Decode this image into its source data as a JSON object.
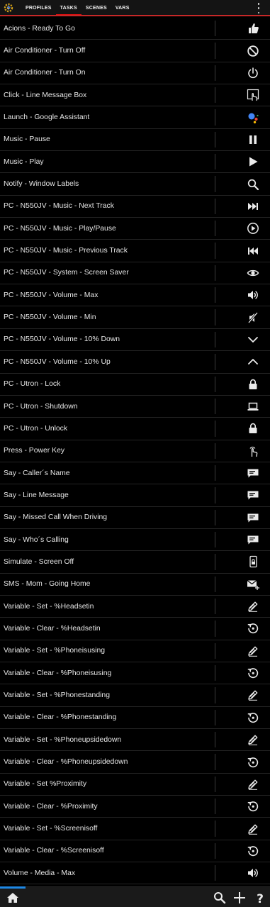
{
  "tabs": [
    {
      "label": "PROFILES",
      "active": false
    },
    {
      "label": "TASKS",
      "active": true
    },
    {
      "label": "SCENES",
      "active": false
    },
    {
      "label": "VARS",
      "active": false
    }
  ],
  "colors": {
    "accent": "#e01010",
    "progress": "#1e88e5",
    "background": "#000000"
  },
  "tasks": [
    {
      "label": "Acions - Ready To Go",
      "icon": "thumbs-up-icon"
    },
    {
      "label": "Air Conditioner - Turn Off",
      "icon": "block-icon"
    },
    {
      "label": "Air Conditioner - Turn On",
      "icon": "power-icon"
    },
    {
      "label": "Click - Line Message Box",
      "icon": "touch-box-icon"
    },
    {
      "label": "Launch - Google Assistant",
      "icon": "google-assistant-icon"
    },
    {
      "label": "Music - Pause",
      "icon": "pause-icon"
    },
    {
      "label": "Music - Play",
      "icon": "play-icon"
    },
    {
      "label": "Notify - Window Labels",
      "icon": "search-icon"
    },
    {
      "label": "PC - N550JV - Music - Next Track",
      "icon": "next-track-icon"
    },
    {
      "label": "PC - N550JV - Music - Play/Pause",
      "icon": "play-circle-icon"
    },
    {
      "label": "PC - N550JV - Music - Previous Track",
      "icon": "previous-track-icon"
    },
    {
      "label": "PC - N550JV - System - Screen Saver",
      "icon": "eye-icon"
    },
    {
      "label": "PC - N550JV - Volume - Max",
      "icon": "volume-up-icon"
    },
    {
      "label": "PC - N550JV - Volume - Min",
      "icon": "volume-off-icon"
    },
    {
      "label": "PC - N550JV - Volume - 10% Down",
      "icon": "chevron-down-icon"
    },
    {
      "label": "PC - N550JV - Volume - 10% Up",
      "icon": "chevron-up-icon"
    },
    {
      "label": "PC - Utron - Lock",
      "icon": "lock-icon"
    },
    {
      "label": "PC - Utron - Shutdown",
      "icon": "laptop-icon"
    },
    {
      "label": "PC - Utron - Unlock",
      "icon": "lock-icon"
    },
    {
      "label": "Press - Power Key",
      "icon": "touch-icon"
    },
    {
      "label": "Say - Caller´s Name",
      "icon": "message-icon"
    },
    {
      "label": "Say - Line Message",
      "icon": "message-icon"
    },
    {
      "label": "Say - Missed Call When Driving",
      "icon": "message-icon"
    },
    {
      "label": "Say - Who´s Calling",
      "icon": "message-icon"
    },
    {
      "label": "Simulate - Screen Off",
      "icon": "phone-lock-icon"
    },
    {
      "label": "SMS - Mom - Going Home",
      "icon": "mail-add-icon"
    },
    {
      "label": "Variable - Set - %Headsetin",
      "icon": "pencil-icon"
    },
    {
      "label": "Variable - Clear - %Headsetin",
      "icon": "reset-icon"
    },
    {
      "label": "Variable - Set - %Phoneisusing",
      "icon": "pencil-icon"
    },
    {
      "label": "Variable - Clear - %Phoneisusing",
      "icon": "reset-icon"
    },
    {
      "label": "Variable - Set - %Phonestanding",
      "icon": "pencil-icon"
    },
    {
      "label": "Variable - Clear - %Phonestanding",
      "icon": "reset-icon"
    },
    {
      "label": "Variable - Set - %Phoneupsidedown",
      "icon": "pencil-icon"
    },
    {
      "label": "Variable - Clear - %Phoneupsidedown",
      "icon": "reset-icon"
    },
    {
      "label": "Variable - Set %Proximity",
      "icon": "pencil-icon"
    },
    {
      "label": "Variable - Clear - %Proximity",
      "icon": "reset-icon"
    },
    {
      "label": "Variable - Set - %Screenisoff",
      "icon": "pencil-icon"
    },
    {
      "label": "Variable - Clear - %Screenisoff",
      "icon": "reset-icon"
    },
    {
      "label": "Volume - Media - Max",
      "icon": "volume-up-icon"
    }
  ],
  "bottombar": {
    "icons": [
      "home-icon",
      "search-icon",
      "add-icon",
      "help-icon"
    ]
  }
}
